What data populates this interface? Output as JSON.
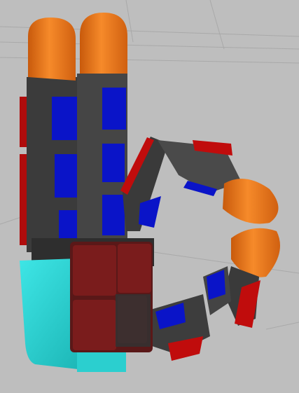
{
  "scene": {
    "kind": "3d-robot-hand-viewport",
    "colors": {
      "background": "#bebebe",
      "grid": "#a8a8a8",
      "fingertip": "#f07a1c",
      "fingertip_shade": "#b8520a",
      "link_dark": "#3a3a3a",
      "link_mid": "#555555",
      "pad_blue": "#0a14c8",
      "side_red": "#c00c0c",
      "palm_pad": "#7a1c1c",
      "palm_base": "#2ad4d4"
    }
  }
}
